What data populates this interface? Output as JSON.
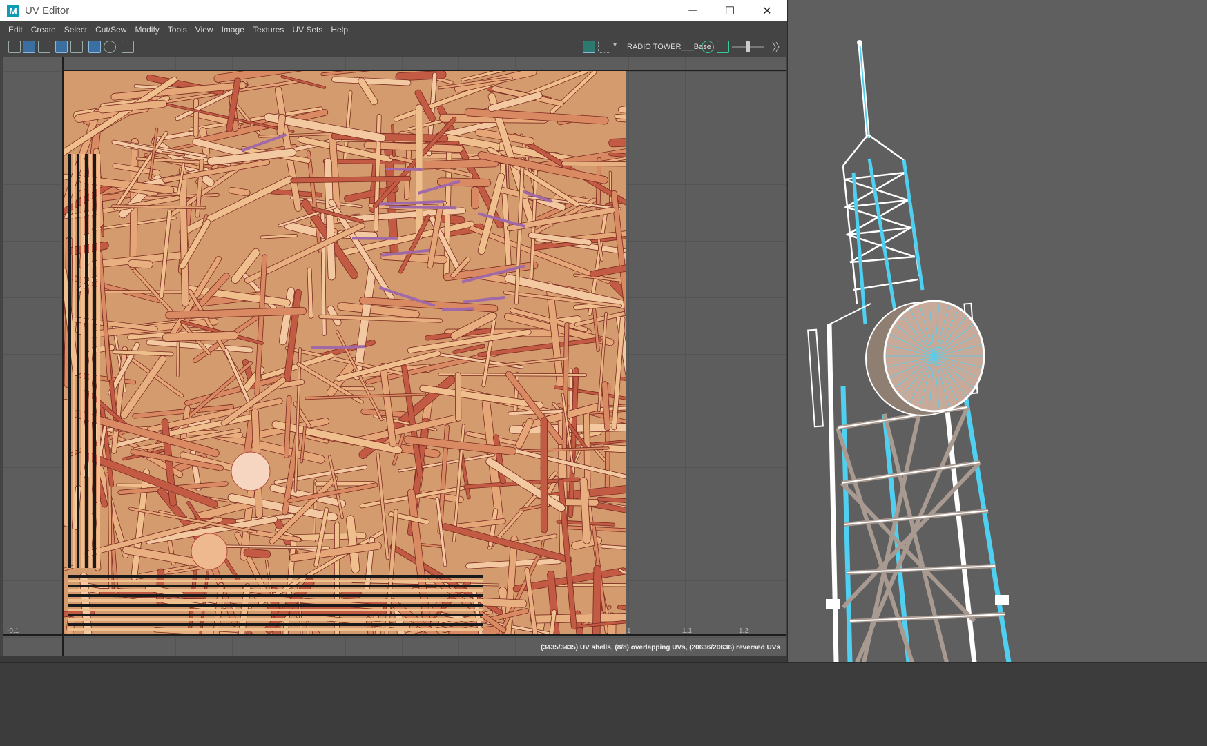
{
  "window": {
    "app_logo": "M",
    "title": "UV Editor",
    "minimize_icon": "─",
    "maximize_icon": "☐",
    "close_icon": "✕"
  },
  "menu": [
    "Edit",
    "Create",
    "Select",
    "Cut/Sew",
    "Modify",
    "Tools",
    "View",
    "Image",
    "Textures",
    "UV Sets",
    "Help"
  ],
  "toolbar": {
    "texture_label": "RADIO TOWER___Base"
  },
  "viewport": {
    "ticks": [
      "-0.1",
      "1",
      "1.1",
      "1.2"
    ],
    "status": "(3435/3435) UV shells, (8/8) overlapping UVs, (20636/20636) reversed UVs"
  },
  "colors": {
    "title_bg": "#ffffff",
    "panel_bg": "#444444",
    "viewport_bg": "#5d5d5d",
    "uv_wire_cyan": "#4fd0f0",
    "uv_shell_fill": "#e8b080",
    "uv_shell_red": "#b8483a"
  }
}
